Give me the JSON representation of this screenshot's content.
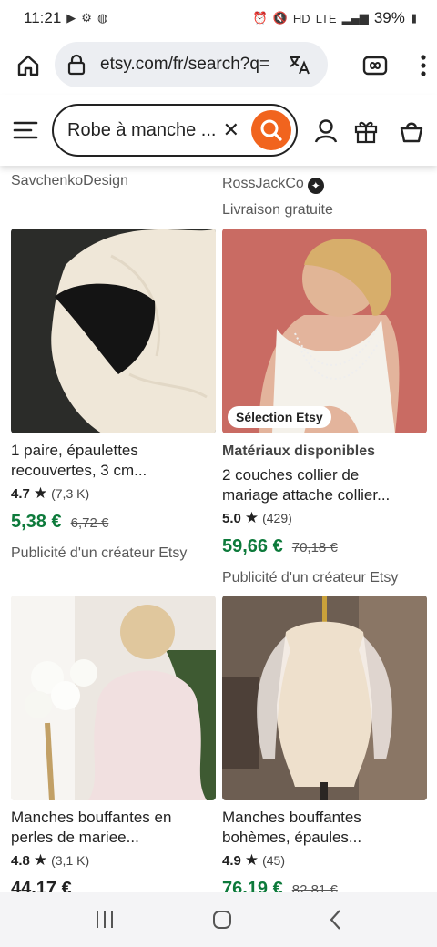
{
  "status": {
    "time": "11:21",
    "battery": "39%",
    "net": "LTE"
  },
  "browser": {
    "url": "etsy.com/fr/search?q="
  },
  "header": {
    "search_value": "Robe à manche ..."
  },
  "top_labels": {
    "left_shop": "SavchenkoDesign",
    "right_shop": "RossJackCo",
    "right_shipping": "Livraison gratuite"
  },
  "listings": [
    {
      "kicker": "",
      "title_line1": "1 paire, épaulettes",
      "title_line2": "recouvertes, 3 cm...",
      "score": "4.7",
      "count": "(7,3 K)",
      "price": "5,38 €",
      "old_price": "6,72 €",
      "ad": "Publicité d'un créateur Etsy"
    },
    {
      "badge": "Sélection Etsy",
      "kicker": "Matériaux disponibles",
      "title_line1": "2 couches collier de",
      "title_line2": "mariage attache collier...",
      "score": "5.0",
      "count": "(429)",
      "price": "59,66 €",
      "old_price": "70,18 €",
      "ad": "Publicité d'un créateur Etsy"
    },
    {
      "title_line1": "Manches bouffantes en",
      "title_line2": "perles de mariee...",
      "score": "4.8",
      "count": "(3,1 K)",
      "price": "44,17 €"
    },
    {
      "title_line1": "Manches bouffantes",
      "title_line2": "bohèmes, épaules...",
      "score": "4.9",
      "count": "(45)",
      "price": "76,19 €",
      "old_price": "82,81 €"
    }
  ],
  "colors": {
    "etsy_orange": "#f1641e",
    "price_green": "#0d7a3b"
  }
}
